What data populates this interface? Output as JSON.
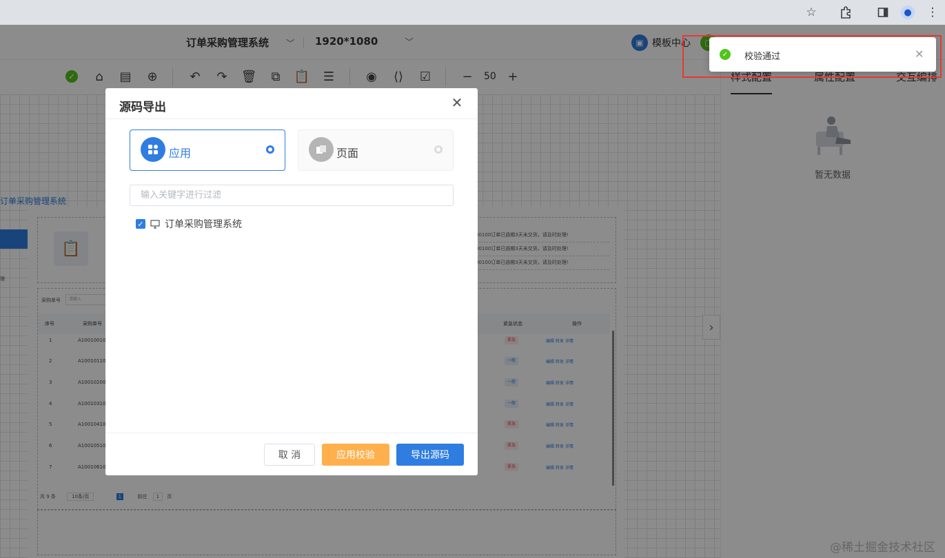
{
  "browser": {
    "icons": [
      "star-icon",
      "extension-icon",
      "sidepanel-icon",
      "profile-icon",
      "menu-icon"
    ]
  },
  "header": {
    "project_name": "订单采购管理系统",
    "resolution": "1920*1080",
    "template_center": "模板中心"
  },
  "toolbar": {
    "zoom": "50",
    "minus": "−",
    "plus": "+"
  },
  "right_panel": {
    "tabs": [
      "样式配置",
      "属性配置",
      "交互编排"
    ],
    "empty_text": "暂无数据"
  },
  "preview": {
    "title": "订单采购管理系统",
    "notices": [
      "00100订单已逾期3天未交货，请及时处理!",
      "00100订单已逾期3天未交货，请及时处理!",
      "00100订单已逾期3天未交货，请及时处理!"
    ],
    "search_label": "采购单号",
    "search_placeholder": "请输入",
    "columns": [
      "序号",
      "采购单号",
      "紧急状态",
      "操作"
    ],
    "rows": [
      {
        "no": "1",
        "code": "A10010010",
        "status": "紧急"
      },
      {
        "no": "2",
        "code": "A10010110",
        "status": "一般"
      },
      {
        "no": "3",
        "code": "A10010200",
        "status": "一般"
      },
      {
        "no": "4",
        "code": "A10010310",
        "status": "一般"
      },
      {
        "no": "5",
        "code": "A10010410",
        "status": "紧急"
      },
      {
        "no": "6",
        "code": "A10010510",
        "status": "紧急"
      },
      {
        "no": "7",
        "code": "A10010610",
        "status": "紧急"
      }
    ],
    "ops": "编辑  转发  详情",
    "pager_total": "共 9 条",
    "pager_size": "10条/页",
    "pager_page": "1",
    "pager_goto": "前往",
    "pager_goto_page": "1",
    "pager_unit": "页"
  },
  "dialog": {
    "title": "源码导出",
    "options": [
      {
        "label": "应用",
        "selected": true
      },
      {
        "label": "页面",
        "selected": false
      }
    ],
    "filter_placeholder": "输入关键字进行过滤",
    "filter_value": "",
    "tree_item": "订单采购管理系统",
    "buttons": {
      "cancel": "取 消",
      "validate": "应用校验",
      "export": "导出源码"
    }
  },
  "toast": {
    "message": "校验通过"
  },
  "watermark": "@稀土掘金技术社区",
  "colors": {
    "primary": "#2f7de1",
    "warning": "#ffb04d",
    "success": "#52c41a",
    "highlight": "#e53935"
  }
}
